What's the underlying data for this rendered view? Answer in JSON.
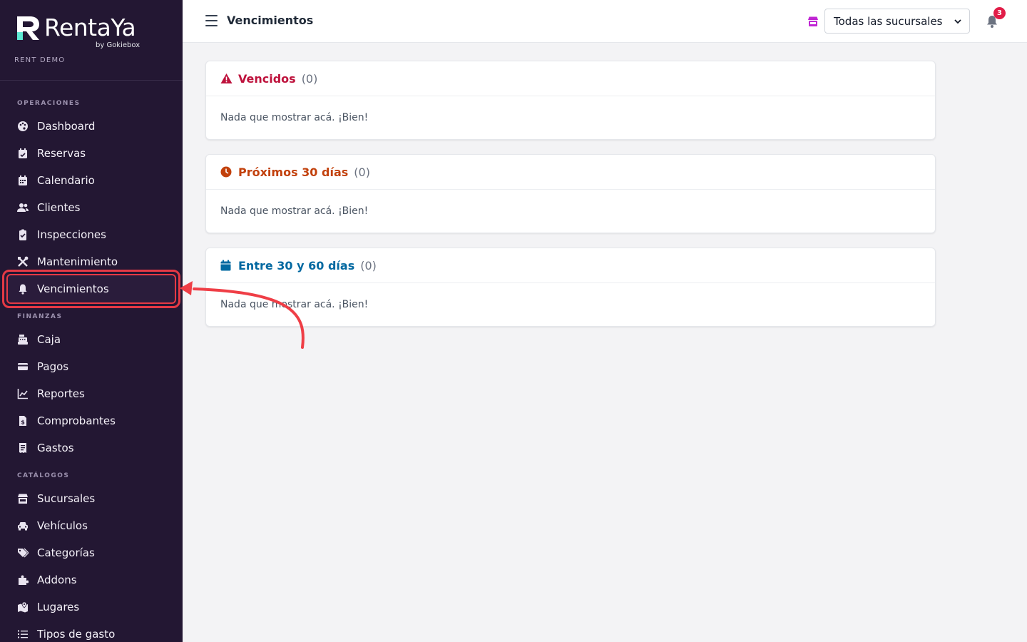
{
  "brand": {
    "name": "RentaYa",
    "sub": "by Gokiebox",
    "tenant": "RENT DEMO"
  },
  "sidebar": {
    "sections": [
      {
        "label": "OPERACIONES"
      },
      {
        "label": "FINANZAS"
      },
      {
        "label": "CATÁLOGOS"
      }
    ],
    "items": [
      {
        "label": "Dashboard",
        "icon": "palette-icon"
      },
      {
        "label": "Reservas",
        "icon": "calendar-check-icon"
      },
      {
        "label": "Calendario",
        "icon": "calendar-icon"
      },
      {
        "label": "Clientes",
        "icon": "users-icon"
      },
      {
        "label": "Inspecciones",
        "icon": "clipboard-check-icon"
      },
      {
        "label": "Mantenimiento",
        "icon": "tools-icon"
      },
      {
        "label": "Vencimientos",
        "icon": "bell-icon"
      },
      {
        "label": "Caja",
        "icon": "cash-register-icon"
      },
      {
        "label": "Pagos",
        "icon": "credit-card-icon"
      },
      {
        "label": "Reportes",
        "icon": "chart-line-icon"
      },
      {
        "label": "Comprobantes",
        "icon": "invoice-icon"
      },
      {
        "label": "Gastos",
        "icon": "receipt-icon"
      },
      {
        "label": "Sucursales",
        "icon": "store-icon"
      },
      {
        "label": "Vehículos",
        "icon": "car-icon"
      },
      {
        "label": "Categorías",
        "icon": "tags-icon"
      },
      {
        "label": "Addons",
        "icon": "puzzle-icon"
      },
      {
        "label": "Lugares",
        "icon": "map-location-icon"
      },
      {
        "label": "Tipos de gasto",
        "icon": "list-icon"
      }
    ],
    "active": "Vencimientos"
  },
  "topbar": {
    "title": "Vencimientos",
    "branch_selected": "Todas las sucursales",
    "notification_count": "3"
  },
  "cards": [
    {
      "title": "Vencidos",
      "count": "(0)",
      "color": "#be123c",
      "icon": "warning-icon",
      "empty": "Nada que mostrar acá. ¡Bien!"
    },
    {
      "title": "Próximos 30 días",
      "count": "(0)",
      "color": "#c2410c",
      "icon": "clock-icon",
      "empty": "Nada que mostrar acá. ¡Bien!"
    },
    {
      "title": "Entre 30 y 60 días",
      "count": "(0)",
      "color": "#0369a1",
      "icon": "calendar-icon",
      "empty": "Nada que mostrar acá. ¡Bien!"
    }
  ],
  "colors": {
    "sidebar_bg": "#231733",
    "accent": "#c026d3",
    "highlight": "#e53945"
  }
}
